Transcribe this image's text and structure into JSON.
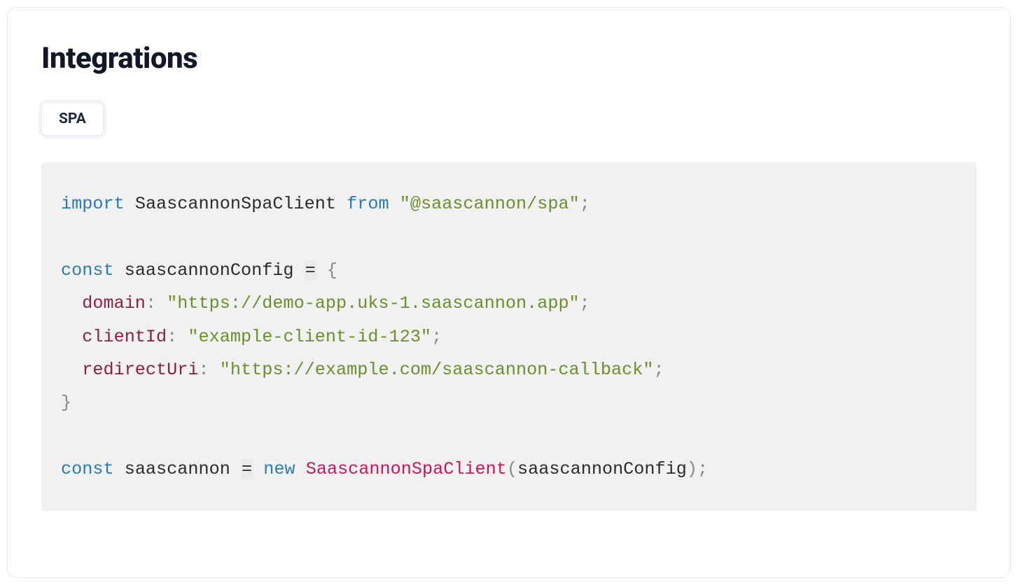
{
  "header": {
    "title": "Integrations"
  },
  "tabs": {
    "active": "SPA"
  },
  "code": {
    "import_kw": "import",
    "import_ident": "SaascannonSpaClient",
    "from_kw": "from",
    "import_src": "\"@saascannon/spa\"",
    "const1_kw": "const",
    "config_ident": "saascannonConfig",
    "eq": "=",
    "lbrace": "{",
    "domain_key": "domain",
    "domain_val": "\"https://demo-app.uks-1.saascannon.app\"",
    "clientId_key": "clientId",
    "clientId_val": "\"example-client-id-123\"",
    "redirectUri_key": "redirectUri",
    "redirectUri_val": "\"https://example.com/saascannon-callback\"",
    "rbrace": "}",
    "const2_kw": "const",
    "inst_ident": "saascannon",
    "new_kw": "new",
    "cls_name": "SaascannonSpaClient",
    "arg_ident": "saascannonConfig",
    "semi": ";",
    "colon": ":",
    "lparen": "(",
    "rparen": ")"
  }
}
